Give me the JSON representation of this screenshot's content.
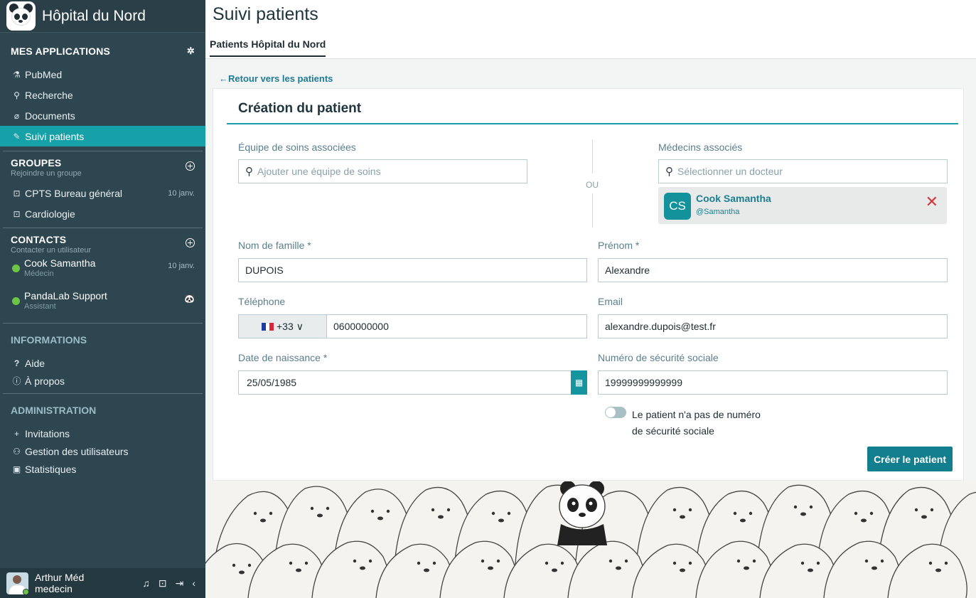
{
  "org": {
    "name": "Hôpital du Nord"
  },
  "sidebar": {
    "apps_title": "MES APPLICATIONS",
    "apps": [
      {
        "label": "PubMed",
        "icon": "flask-icon"
      },
      {
        "label": "Recherche",
        "icon": "search-icon"
      },
      {
        "label": "Documents",
        "icon": "paperclip-icon"
      },
      {
        "label": "Suivi patients",
        "icon": "edit-document-icon"
      }
    ],
    "groups_title": "GROUPES",
    "groups_sub": "Rejoindre un groupe",
    "groups": [
      {
        "label": "CPTS Bureau général",
        "date": "10 janv."
      },
      {
        "label": "Cardiologie",
        "date": ""
      }
    ],
    "contacts_title": "CONTACTS",
    "contacts_sub": "Contacter un utilisateur",
    "contacts": [
      {
        "name": "Cook Samantha",
        "role": "Médecin",
        "date": "10 janv."
      },
      {
        "name": "PandaLab Support",
        "role": "Assistant",
        "date": ""
      }
    ],
    "info_title": "INFORMATIONS",
    "info": [
      {
        "label": "Aide",
        "icon": "question-icon"
      },
      {
        "label": "À propos",
        "icon": "info-icon"
      }
    ],
    "admin_title": "ADMINISTRATION",
    "admin": [
      {
        "label": "Invitations",
        "icon": "plus-icon"
      },
      {
        "label": "Gestion des utilisateurs",
        "icon": "users-icon"
      },
      {
        "label": "Statistiques",
        "icon": "chart-icon"
      }
    ],
    "user": {
      "name": "Arthur Méd",
      "role": "medecin"
    }
  },
  "header": {
    "title": "Suivi patients",
    "tab": "Patients Hôpital du Nord"
  },
  "back_link": "Retour vers les patients",
  "form": {
    "title": "Création du patient",
    "care_team_label": "Équipe de soins associées",
    "care_team_placeholder": "Ajouter une équipe de soins",
    "or_text": "OU",
    "doctors_label": "Médecins associés",
    "doctors_placeholder": "Sélectionner un docteur",
    "selected_doctor": {
      "initials": "CS",
      "name": "Cook Samantha",
      "handle": "@Samantha"
    },
    "last_name_label": "Nom de famille *",
    "last_name_value": "DUPOIS",
    "first_name_label": "Prénom *",
    "first_name_value": "Alexandre",
    "phone_label": "Téléphone",
    "phone_code": "+33",
    "phone_value": "0600000000",
    "email_label": "Email",
    "email_value": "alexandre.dupois@test.fr",
    "birth_label": "Date de naissance *",
    "birth_value": "25/05/1985",
    "ssn_label": "Numéro de sécurité sociale",
    "ssn_value": "19999999999999",
    "no_ssn_line1": "Le patient n'a pas de numéro",
    "no_ssn_line2": "de sécurité sociale",
    "no_ssn_toggle": false,
    "submit_label": "Créer le patient"
  },
  "colors": {
    "sidebar": "#2e4650",
    "accent": "#16a0a8",
    "button": "#137f8e",
    "danger": "#d4353a"
  }
}
